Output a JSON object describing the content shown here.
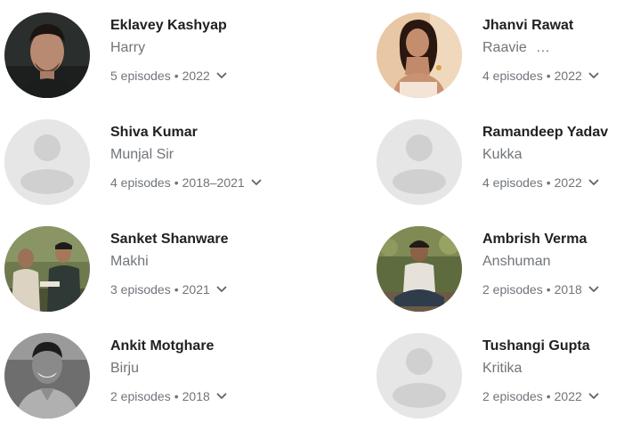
{
  "cast": [
    {
      "name": "Eklavey Kashyap",
      "role": "Harry",
      "episodes": "5 episodes",
      "years": "2022",
      "avatar": "photo-man-portrait"
    },
    {
      "name": "Jhanvi Rawat",
      "role": "Raavie",
      "role_ellipsis": "…",
      "episodes": "4 episodes",
      "years": "2022",
      "avatar": "photo-woman-portrait"
    },
    {
      "name": "Shiva Kumar",
      "role": "Munjal Sir",
      "episodes": "4 episodes",
      "years": "2018–2021",
      "avatar": "placeholder-person"
    },
    {
      "name": "Ramandeep Yadav",
      "role": "Kukka",
      "episodes": "4 episodes",
      "years": "2022",
      "avatar": "placeholder-person"
    },
    {
      "name": "Sanket Shanware",
      "role": "Makhi",
      "episodes": "3 episodes",
      "years": "2021",
      "avatar": "photo-two-men-outdoors"
    },
    {
      "name": "Ambrish Verma",
      "role": "Anshuman",
      "episodes": "2 episodes",
      "years": "2018",
      "avatar": "photo-man-sitting-outdoors"
    },
    {
      "name": "Ankit Motghare",
      "role": "Birju",
      "episodes": "2 episodes",
      "years": "2018",
      "avatar": "photo-man-smiling-bw"
    },
    {
      "name": "Tushangi Gupta",
      "role": "Kritika",
      "episodes": "2 episodes",
      "years": "2022",
      "avatar": "placeholder-person"
    }
  ],
  "meta_separator": "•",
  "colors": {
    "name_text": "#202124",
    "secondary_text": "#70757a",
    "placeholder_bg": "#e6e6e6",
    "placeholder_figure": "#d0d0d0"
  }
}
